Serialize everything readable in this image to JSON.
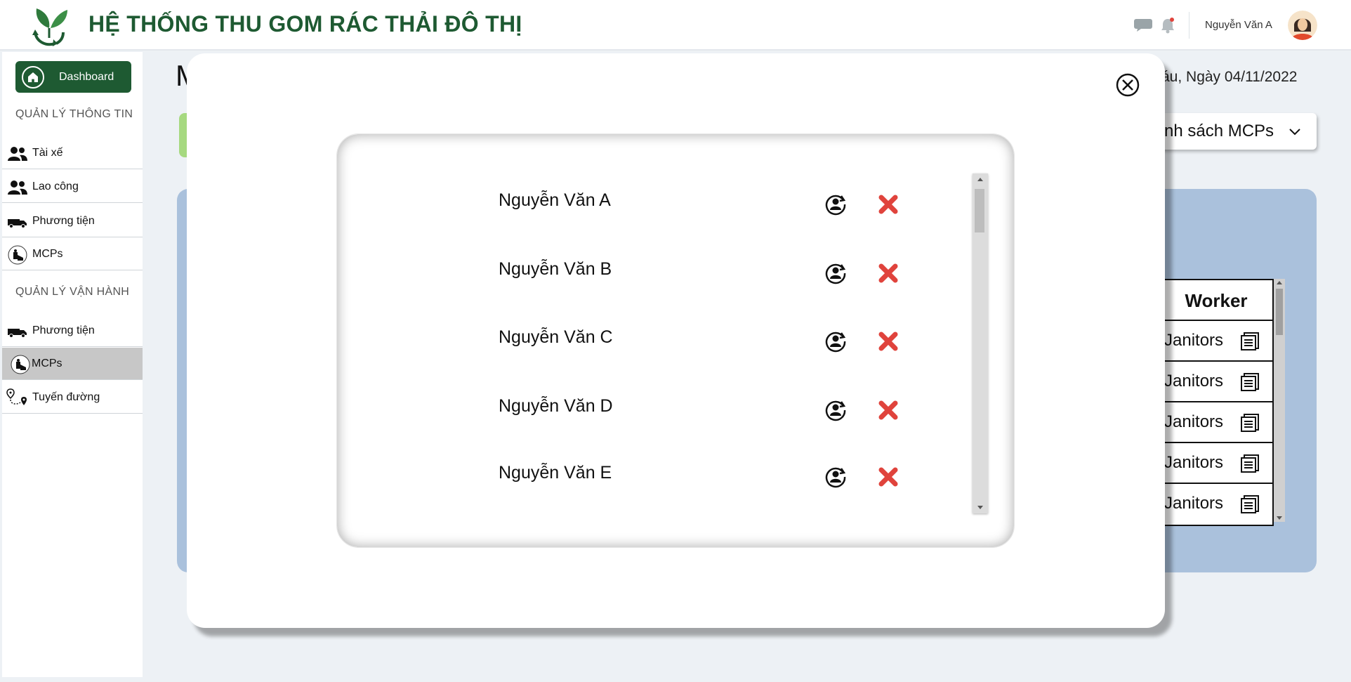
{
  "header": {
    "title": "HỆ THỐNG THU GOM RÁC THẢI ĐÔ THỊ",
    "user_name": "Nguyễn Văn A"
  },
  "sidebar": {
    "dashboard_label": "Dashboard",
    "section_info": "QUẢN LÝ THÔNG TIN",
    "info_items": [
      {
        "label": "Tài xế",
        "icon": "users-icon"
      },
      {
        "label": "Lao công",
        "icon": "users-icon"
      },
      {
        "label": "Phương tiện",
        "icon": "truck-icon"
      },
      {
        "label": "MCPs",
        "icon": "mcp-icon"
      }
    ],
    "section_ops": "QUẢN LÝ VẬN HÀNH",
    "ops_items": [
      {
        "label": "Phương tiện",
        "icon": "truck-icon"
      },
      {
        "label": "MCPs",
        "icon": "mcp-icon",
        "active": true
      },
      {
        "label": "Tuyến đường",
        "icon": "route-icon"
      }
    ]
  },
  "background": {
    "title_fragment": "M",
    "date": "Sáu, Ngày 04/11/2022",
    "dropdown_label": "nh sách MCPs",
    "table_header": "Worker",
    "table_rows": [
      "Janitors",
      "Janitors",
      "Janitors",
      "Janitors",
      "Janitors"
    ]
  },
  "modal": {
    "workers": [
      {
        "name": "Nguyễn Văn A"
      },
      {
        "name": "Nguyễn Văn B"
      },
      {
        "name": "Nguyễn Văn C"
      },
      {
        "name": "Nguyễn Văn D"
      },
      {
        "name": "Nguyễn Văn E"
      }
    ]
  },
  "colors": {
    "brand_green": "#1e5a32",
    "panel_blue": "#aac1dc",
    "chip_green": "#a6d980",
    "remove_red": "#e0433c",
    "active_gray": "#c7c7c7"
  }
}
